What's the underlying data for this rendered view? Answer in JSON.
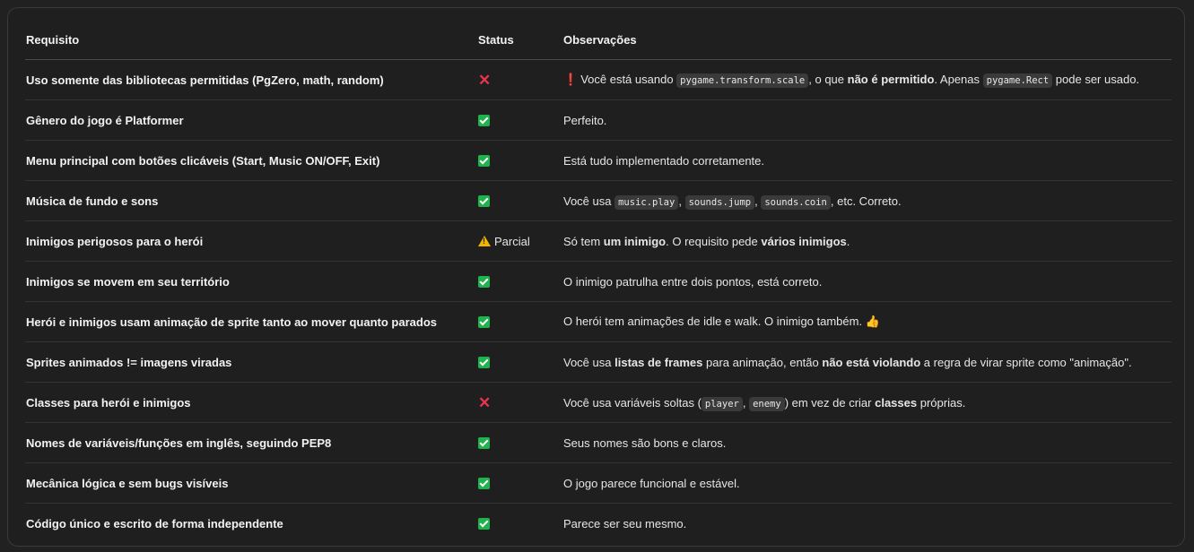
{
  "table": {
    "headers": {
      "requirement": "Requisito",
      "status": "Status",
      "observations": "Observações"
    },
    "rows": [
      {
        "requirement": "Uso somente das bibliotecas permitidas (PgZero, math, random)",
        "status": "fail",
        "obs": {
          "icon": "❗",
          "t1": "Você está usando ",
          "c1": "pygame.transform.scale",
          "t2": ", o que ",
          "b1": "não é permitido",
          "t3": ". Apenas ",
          "c2": "pygame.Rect",
          "t4": " pode ser usado."
        }
      },
      {
        "requirement": "Gênero do jogo é Platformer",
        "status": "ok",
        "obs": {
          "t1": "Perfeito."
        }
      },
      {
        "requirement": "Menu principal com botões clicáveis (Start, Music ON/OFF, Exit)",
        "status": "ok",
        "obs": {
          "t1": "Está tudo implementado corretamente."
        }
      },
      {
        "requirement": "Música de fundo e sons",
        "status": "ok",
        "obs": {
          "t1": "Você usa ",
          "c1": "music.play",
          "t2": ", ",
          "c2": "sounds.jump",
          "t3": ", ",
          "c3": "sounds.coin",
          "t4": ", etc. Correto."
        }
      },
      {
        "requirement": "Inimigos perigosos para o herói",
        "status": "partial",
        "status_label": "Parcial",
        "obs": {
          "t1": "Só tem ",
          "b1": "um inimigo",
          "t2": ". O requisito pede ",
          "b2": "vários inimigos",
          "t3": "."
        }
      },
      {
        "requirement": "Inimigos se movem em seu território",
        "status": "ok",
        "obs": {
          "t1": "O inimigo patrulha entre dois pontos, está correto."
        }
      },
      {
        "requirement": "Herói e inimigos usam animação de sprite tanto ao mover quanto parados",
        "status": "ok",
        "obs": {
          "t1": "O herói tem animações de idle e walk. O inimigo também. ",
          "emoji": "👍"
        }
      },
      {
        "requirement": "Sprites animados != imagens viradas",
        "status": "ok",
        "obs": {
          "t1": "Você usa ",
          "b1": "listas de frames",
          "t2": " para animação, então ",
          "b2": "não está violando",
          "t3": " a regra de virar sprite como \"animação\"."
        }
      },
      {
        "requirement": "Classes para herói e inimigos",
        "status": "fail",
        "obs": {
          "t1": "Você usa variáveis soltas (",
          "c1": "player",
          "t2": ", ",
          "c2": "enemy",
          "t3": ") em vez de criar ",
          "b1": "classes",
          "t4": " próprias."
        }
      },
      {
        "requirement": "Nomes de variáveis/funções em inglês, seguindo PEP8",
        "status": "ok",
        "obs": {
          "t1": "Seus nomes são bons e claros."
        }
      },
      {
        "requirement": "Mecânica lógica e sem bugs visíveis",
        "status": "ok",
        "obs": {
          "t1": "O jogo parece funcional e estável."
        }
      },
      {
        "requirement": "Código único e escrito de forma independente",
        "status": "ok",
        "obs": {
          "t1": "Parece ser seu mesmo."
        }
      }
    ]
  },
  "icons": {
    "ok": "check-box-icon",
    "fail": "cross-icon",
    "partial": "warning-icon"
  },
  "colors": {
    "background": "#212121",
    "ok": "#20b24c",
    "fail": "#e8344f",
    "warning": "#f4b400",
    "code_bg": "#3a3a3a"
  }
}
